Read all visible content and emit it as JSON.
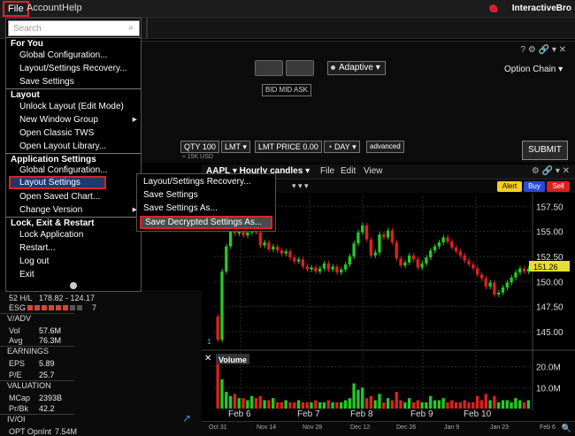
{
  "menubar": {
    "file": "File",
    "account": "Account",
    "help": "Help",
    "brand": "InteractiveBro"
  },
  "search": {
    "placeholder": "Search"
  },
  "file_menu": {
    "sections": [
      {
        "header": "For You",
        "items": [
          "Global Configuration...",
          "Layout/Settings Recovery...",
          "Save Settings"
        ]
      },
      {
        "header": "Layout",
        "items": [
          "Unlock Layout (Edit Mode)",
          "New Window Group",
          "Open Classic TWS",
          "Open Layout Library..."
        ]
      },
      {
        "header": "Application Settings",
        "items": [
          "Global Configuration...",
          "Layout Settings",
          "Open Saved Chart...",
          "Change Version"
        ]
      },
      {
        "header": "Lock, Exit & Restart",
        "items": [
          "Lock Application",
          "Restart...",
          "Log out",
          "Exit"
        ]
      }
    ]
  },
  "sub_menu": {
    "items": [
      "Layout/Settings Recovery...",
      "Save Settings",
      "Save Settings As...",
      "Save Decrypted Settings As..."
    ]
  },
  "order_panel": {
    "bid_mid_ask": "BID MID ASK",
    "adaptive": "Adaptive",
    "option_chain": "Option Chain",
    "qty_label": "QTY",
    "qty": "100",
    "order_type": "LMT",
    "lmt_price_label": "LMT PRICE",
    "lmt_price": "0.00",
    "tif": "DAY",
    "advanced": "advanced",
    "submit": "SUBMIT",
    "usd": "≈ 15K USD"
  },
  "left_panel": {
    "hl_label": "52 H/L",
    "hl_value": "178.82 - 124.17",
    "esg_label": "ESG",
    "esg_value": "7",
    "vadv_header": "V/ADV",
    "vol_label": "Vol",
    "vol_value": "57.6M",
    "avg_label": "Avg",
    "avg_value": "76.3M",
    "earnings_header": "EARNINGS",
    "eps_label": "EPS",
    "eps_value": "5.89",
    "pe_label": "P/E",
    "pe_value": "25.7",
    "valuation_header": "VALUATION",
    "mcap_label": "MCap",
    "mcap_value": "2393B",
    "prbk_label": "Pr/Bk",
    "prbk_value": "42.2",
    "ivoi_header": "IV/OI",
    "opt_label": "OPT OpnInt",
    "opt_value": "7.54M"
  },
  "chart": {
    "tab": "AAPL ▾ Hourly candles ▾",
    "file": "File",
    "edit": "Edit",
    "view": "View",
    "alert": "Alert",
    "buy": "Buy",
    "sell": "Sell",
    "volume_label": "Volume",
    "last_price": "151.26",
    "price_ticks": [
      "157.50",
      "155.00",
      "152.50",
      "150.00",
      "147.50",
      "145.00"
    ],
    "volume_ticks": [
      "20.0M",
      "10.0M"
    ],
    "day_labels": [
      "Feb 6",
      "Feb 7",
      "Feb 8",
      "Feb 9",
      "Feb 10"
    ],
    "timeline_labels": [
      "Oct 31",
      "Nov 14",
      "Nov 28",
      "Dec 12",
      "Dec 26",
      "Jan 9",
      "Jan 23",
      "Feb 6"
    ],
    "up_color": "#22cc22",
    "down_color": "#e02020"
  },
  "chart_data": {
    "type": "candlestick",
    "title": "AAPL Hourly candles",
    "ylim": [
      143.5,
      158.5
    ],
    "candles_close": [
      144.2,
      151.0,
      153.5,
      155.2,
      154.8,
      155.3,
      154.6,
      154.9,
      155.4,
      154.9,
      153.6,
      153.9,
      153.2,
      153.5,
      153.1,
      152.8,
      153.0,
      152.4,
      152.0,
      152.2,
      151.5,
      151.2,
      151.4,
      151.0,
      151.3,
      151.8,
      151.2,
      151.5,
      150.9,
      151.2,
      151.7,
      152.5,
      153.8,
      154.9,
      155.6,
      154.2,
      152.6,
      152.9,
      154.7,
      154.4,
      155.1,
      153.9,
      152.3,
      151.6,
      151.9,
      152.6,
      152.2,
      151.4,
      151.8,
      152.4,
      153.1,
      153.5,
      153.9,
      154.4,
      154.0,
      153.4,
      153.0,
      152.6,
      152.1,
      151.7,
      151.3,
      150.7,
      150.3,
      149.5,
      149.9,
      148.7,
      148.9,
      149.4,
      149.9,
      150.4,
      150.9,
      151.3,
      151.0,
      151.26
    ],
    "volume_millions": [
      24,
      14,
      8,
      6,
      7,
      5,
      5,
      4,
      6,
      5,
      6,
      4,
      4,
      5,
      3,
      3,
      4,
      3,
      3,
      4,
      3,
      3,
      3,
      4,
      3,
      3,
      4,
      3,
      3,
      3,
      4,
      5,
      12,
      9,
      10,
      5,
      6,
      4,
      7,
      3,
      5,
      4,
      8,
      4,
      3,
      5,
      3,
      4,
      3,
      3,
      6,
      4,
      4,
      5,
      3,
      4,
      3,
      3,
      4,
      3,
      3,
      6,
      4,
      7,
      4,
      6,
      3,
      4,
      4,
      3,
      5,
      4,
      3,
      4
    ]
  }
}
